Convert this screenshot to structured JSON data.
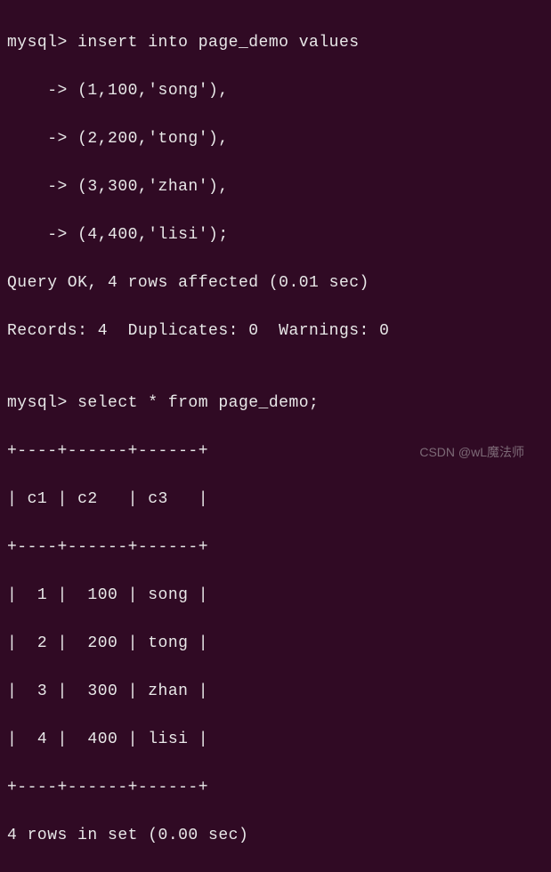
{
  "terminal": {
    "lines": [
      "mysql> insert into page_demo values",
      "    -> (1,100,'song'),",
      "    -> (2,200,'tong'),",
      "    -> (3,300,'zhan'),",
      "    -> (4,400,'lisi');",
      "Query OK, 4 rows affected (0.01 sec)",
      "Records: 4  Duplicates: 0  Warnings: 0",
      "",
      "mysql> select * from page_demo;",
      "+----+------+------+",
      "| c1 | c2   | c3   |",
      "+----+------+------+",
      "|  1 |  100 | song |",
      "|  2 |  200 | tong |",
      "|  3 |  300 | zhan |",
      "|  4 |  400 | lisi |",
      "+----+------+------+",
      "4 rows in set (0.00 sec)"
    ]
  },
  "chart_data": {
    "type": "table",
    "title": "page_demo",
    "columns": [
      "c1",
      "c2",
      "c3"
    ],
    "rows": [
      {
        "c1": 1,
        "c2": 100,
        "c3": "song"
      },
      {
        "c1": 2,
        "c2": 200,
        "c3": "tong"
      },
      {
        "c1": 3,
        "c2": 300,
        "c3": "zhan"
      },
      {
        "c1": 4,
        "c2": 400,
        "c3": "lisi"
      }
    ],
    "query_insert": "insert into page_demo values (1,100,'song'),(2,200,'tong'),(3,300,'zhan'),(4,400,'lisi');",
    "query_select": "select * from page_demo;",
    "insert_result": "Query OK, 4 rows affected (0.01 sec)",
    "insert_stats": "Records: 4  Duplicates: 0  Warnings: 0",
    "select_result": "4 rows in set (0.00 sec)"
  },
  "watermark": "CSDN @wL魔法师"
}
